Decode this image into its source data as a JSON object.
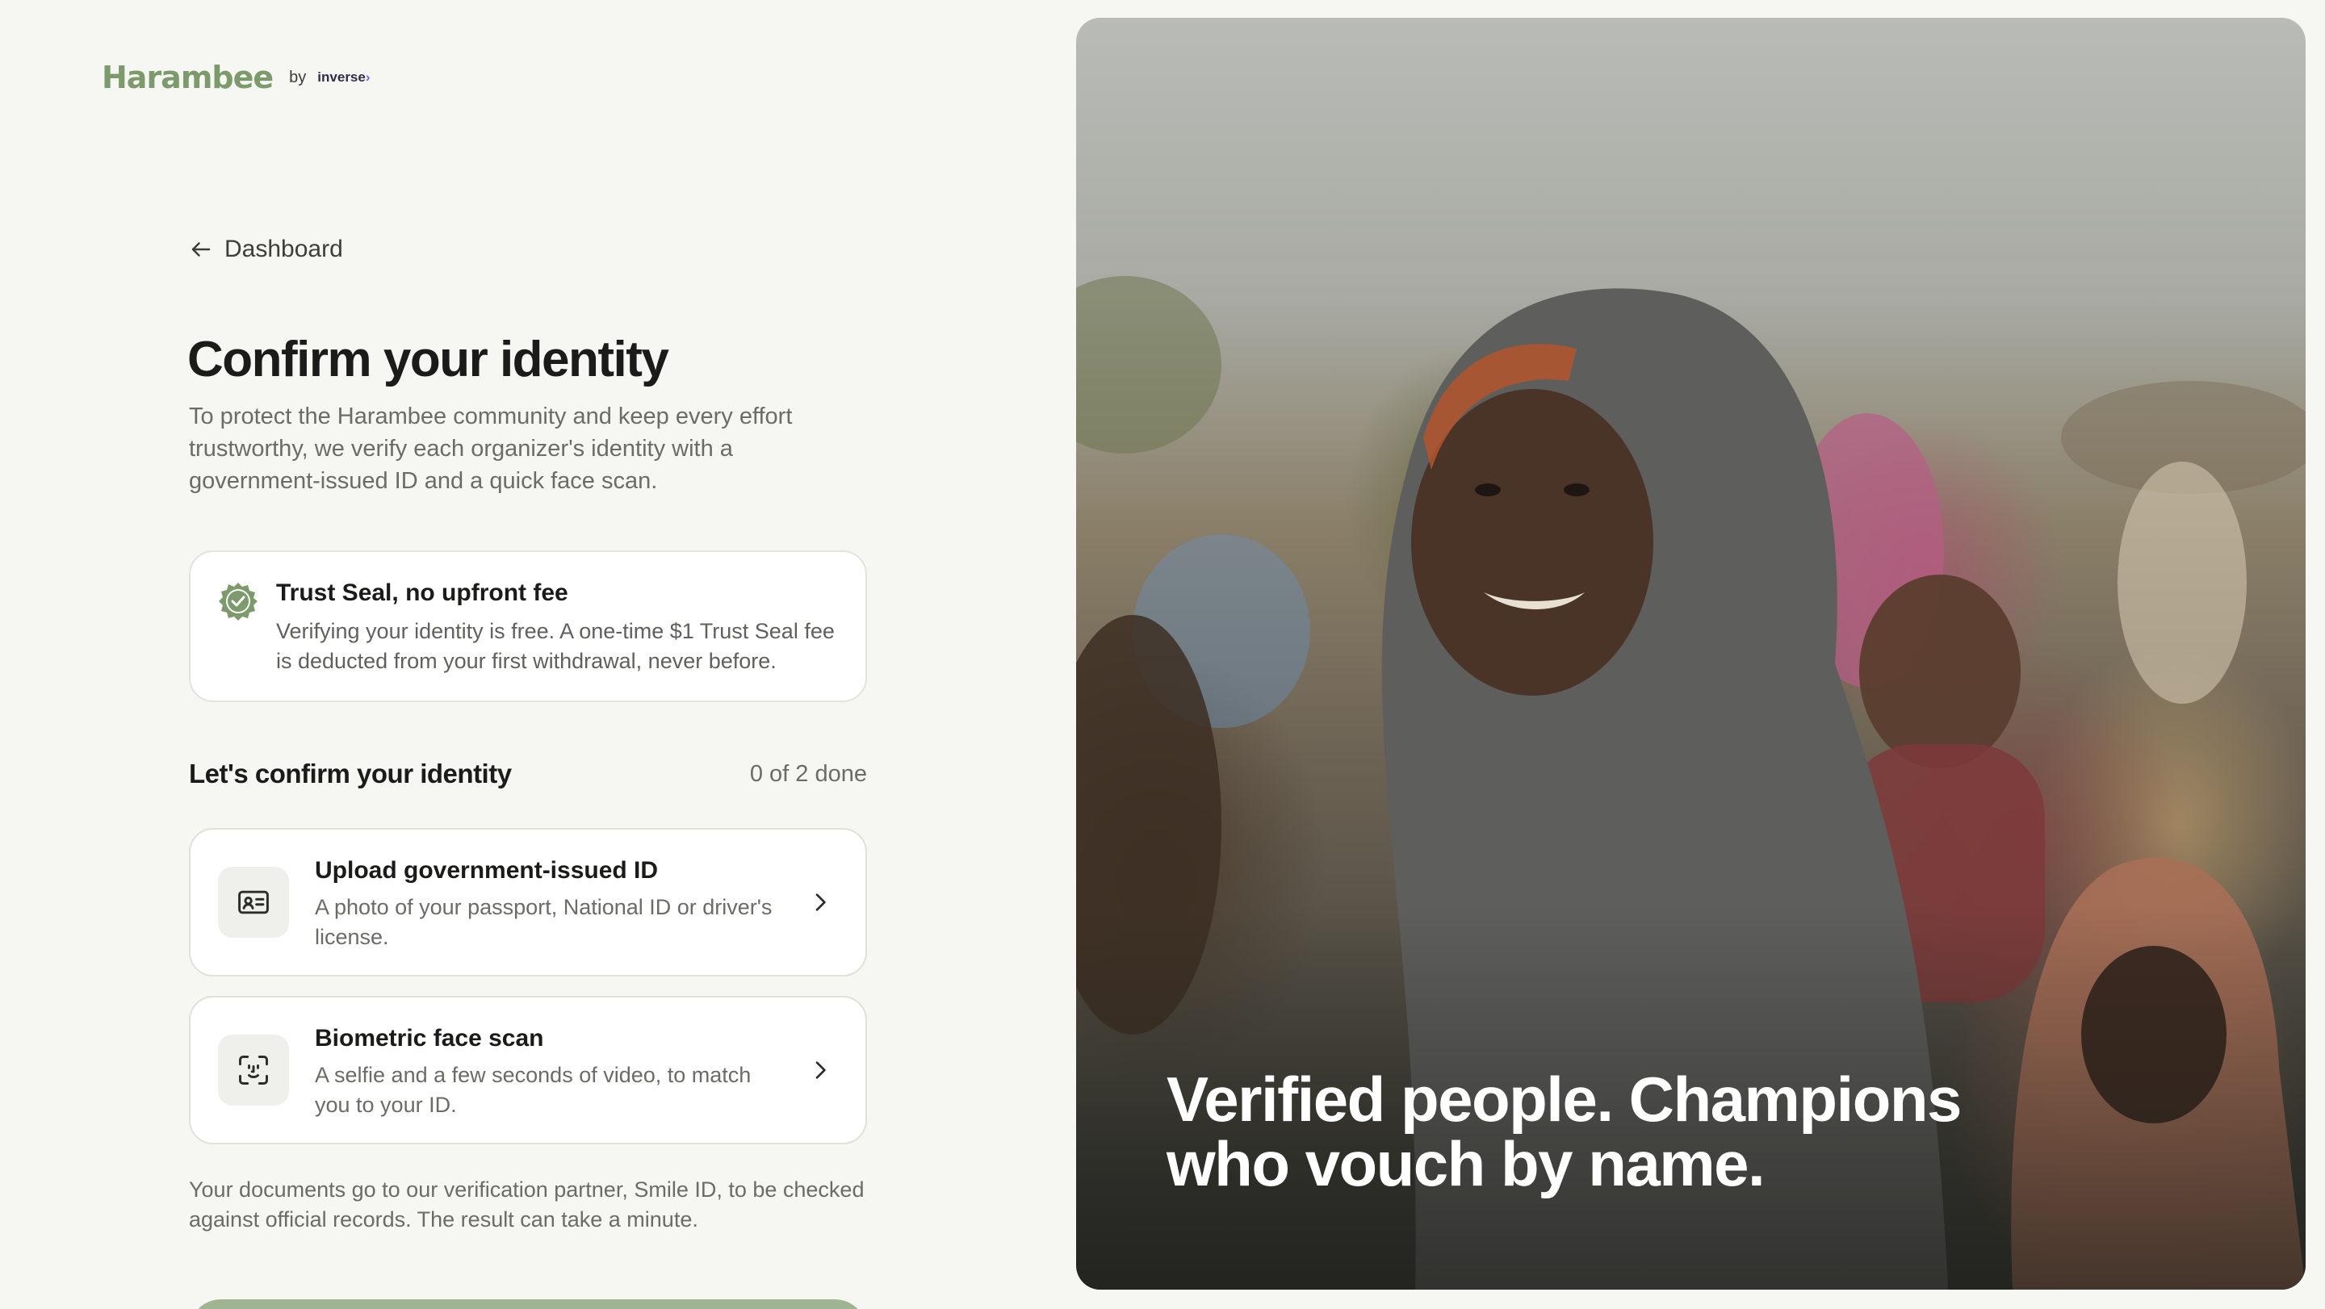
{
  "brand": {
    "name": "Harambee",
    "by": "by",
    "partner": "inverse"
  },
  "nav": {
    "back_label": "Dashboard"
  },
  "header": {
    "title": "Confirm your identity",
    "intro": "To protect the Harambee community and keep every effort trustworthy, we verify each organizer's identity with a government-issued ID and a quick face scan."
  },
  "trust_seal": {
    "title": "Trust Seal, no upfront fee",
    "text": "Verifying your identity is free. A one-time $1 Trust Seal fee is deducted from your first withdrawal, never before.",
    "icon": "verified-badge-icon",
    "icon_color": "#7c9a6c"
  },
  "steps": {
    "title": "Let's confirm your identity",
    "progress": "0 of 2 done",
    "done": 0,
    "total": 2,
    "items": [
      {
        "title": "Upload government-issued ID",
        "description": "A photo of your passport, National ID or driver's license.",
        "icon": "id-card-icon"
      },
      {
        "title": "Biometric face scan",
        "description": "A selfie and a few seconds of video, to match you to your ID.",
        "icon": "face-scan-icon"
      }
    ]
  },
  "footnote": "Your documents go to our verification partner, Smile ID, to be checked against official records. The result can take a minute.",
  "hero": {
    "caption_line1": "Verified people. Champions",
    "caption_line2": "who vouch by name."
  },
  "colors": {
    "background": "#f6f6f2",
    "accent": "#7c9a6c",
    "cta": "#9fb491",
    "text_primary": "#1b1c19",
    "text_muted": "#6a6c66"
  }
}
